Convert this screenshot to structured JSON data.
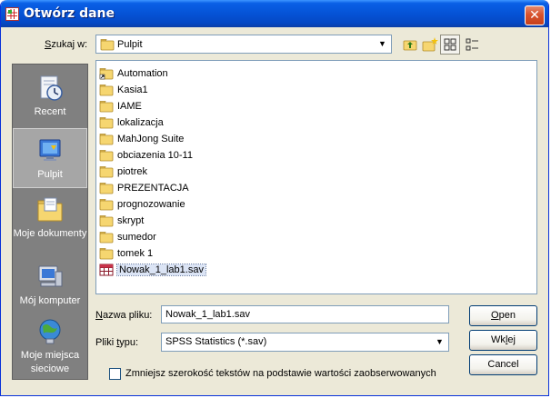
{
  "window": {
    "title": "Otwórz dane",
    "close_glyph": "✕"
  },
  "look_in": {
    "label_pre": "S",
    "label_post": "zukaj w:",
    "value": "Pulpit",
    "icon": "folder-icon"
  },
  "toolbar": {
    "buttons": [
      {
        "name": "up-one-level-icon"
      },
      {
        "name": "new-folder-icon"
      },
      {
        "name": "list-view-icon",
        "pressed": true
      },
      {
        "name": "details-view-icon"
      }
    ]
  },
  "places": [
    {
      "label": "Recent",
      "icon": "recent-documents-icon"
    },
    {
      "label": "Pulpit",
      "icon": "desktop-icon",
      "selected": true
    },
    {
      "label": "Moje dokumenty",
      "icon": "my-documents-icon"
    },
    {
      "label": "Mój komputer",
      "icon": "my-computer-icon"
    },
    {
      "label": "Moje miejsca sieciowe",
      "icon": "network-places-icon"
    }
  ],
  "files": [
    {
      "name": "Automation",
      "type": "folder-shortcut"
    },
    {
      "name": "Kasia1",
      "type": "folder"
    },
    {
      "name": "IAME",
      "type": "folder"
    },
    {
      "name": "lokalizacja",
      "type": "folder"
    },
    {
      "name": "MahJong Suite",
      "type": "folder"
    },
    {
      "name": "obciazenia 10-11",
      "type": "folder"
    },
    {
      "name": "piotrek",
      "type": "folder"
    },
    {
      "name": "PREZENTACJA",
      "type": "folder"
    },
    {
      "name": "prognozowanie",
      "type": "folder"
    },
    {
      "name": "skrypt",
      "type": "folder"
    },
    {
      "name": "sumedor",
      "type": "folder"
    },
    {
      "name": "tomek 1",
      "type": "folder"
    },
    {
      "name": "Nowak_1_lab1.sav",
      "type": "sav-file",
      "selected": true
    }
  ],
  "filename": {
    "label_pre": "",
    "label_ul": "N",
    "label_post": "azwa pliku:",
    "value": "Nowak_1_lab1.sav"
  },
  "filetype": {
    "label_pre": "Pliki ",
    "label_ul": "t",
    "label_post": "ypu:",
    "value": "SPSS Statistics (*.sav)"
  },
  "buttons": {
    "open": {
      "pre": "",
      "ul": "O",
      "post": "pen"
    },
    "paste": {
      "pre": "Wk",
      "ul": "l",
      "post": "ej"
    },
    "cancel": {
      "label": "Cancel"
    }
  },
  "checkbox": {
    "label": "Zmniejsz szerokość tekstów na podstawie wartości zaobserwowanych",
    "checked": false
  }
}
